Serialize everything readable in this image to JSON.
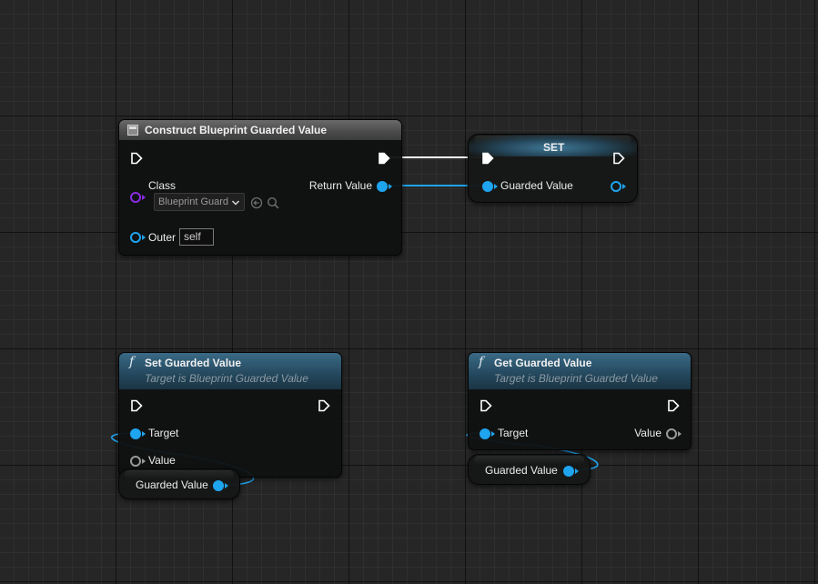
{
  "nodes": {
    "construct": {
      "title": "Construct Blueprint Guarded Value",
      "class_label": "Class",
      "class_value": "Blueprint Guard",
      "return_label": "Return Value",
      "outer_label": "Outer",
      "outer_value": "self"
    },
    "set_node": {
      "title": "SET",
      "pin_label": "Guarded Value"
    },
    "set_func": {
      "title": "Set Guarded Value",
      "subtitle": "Target is Blueprint Guarded Value",
      "target_label": "Target",
      "value_label": "Value"
    },
    "get_func": {
      "title": "Get Guarded Value",
      "subtitle": "Target is Blueprint Guarded Value",
      "target_label": "Target",
      "value_label": "Value"
    },
    "var_get_1": {
      "label": "Guarded Value"
    },
    "var_get_2": {
      "label": "Guarded Value"
    }
  },
  "colors": {
    "object_pin": "#1fa4ef",
    "class_pin": "#8a2be2",
    "exec_pin": "#ffffff",
    "wildcard_pin": "#9a9a9a",
    "grid_major": "#121212",
    "grid_minor": "#2f2f2f"
  },
  "icons": {
    "construct": "blueprint-class-icon",
    "function": "function-f-icon",
    "exec": "exec-arrow-icon",
    "browse": "browse-arrow-icon",
    "search": "search-icon"
  }
}
